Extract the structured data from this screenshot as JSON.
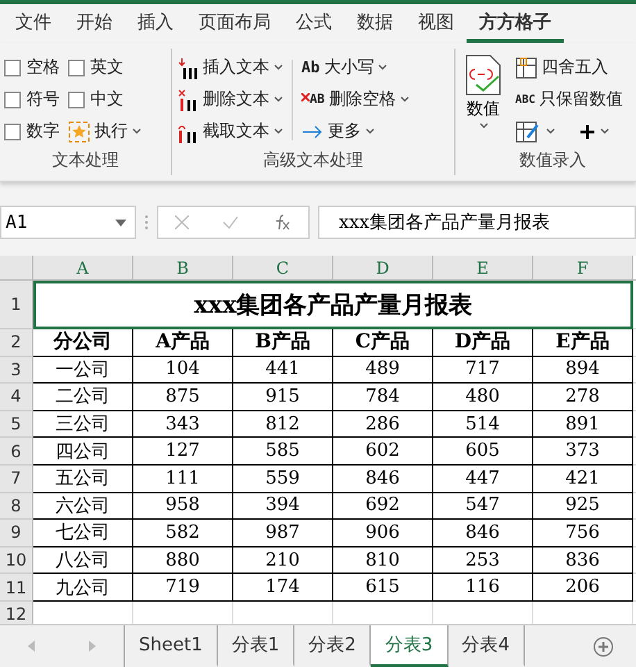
{
  "ribbon_tabs": [
    {
      "label": "文件",
      "selected": false
    },
    {
      "label": "开始",
      "selected": false
    },
    {
      "label": "插入",
      "selected": false
    },
    {
      "label": "页面布局",
      "selected": false
    },
    {
      "label": "公式",
      "selected": false
    },
    {
      "label": "数据",
      "selected": false
    },
    {
      "label": "视图",
      "selected": false
    },
    {
      "label": "方方格子",
      "selected": true
    }
  ],
  "text_group": {
    "label": "文本处理",
    "items": [
      {
        "kind": "checkbox",
        "label": "空格",
        "checked": false
      },
      {
        "kind": "checkbox",
        "label": "英文",
        "checked": false
      },
      {
        "kind": "checkbox",
        "label": "符号",
        "checked": false
      },
      {
        "kind": "checkbox",
        "label": "中文",
        "checked": false
      },
      {
        "kind": "checkbox",
        "label": "数字",
        "checked": false
      },
      {
        "kind": "button",
        "label": "执行"
      }
    ]
  },
  "advanced_group": {
    "label": "高级文本处理",
    "left": [
      {
        "kind": "insert",
        "label": "插入文本"
      },
      {
        "kind": "delete",
        "label": "删除文本"
      },
      {
        "kind": "cut",
        "label": "截取文本"
      }
    ],
    "right": [
      {
        "kind": "case",
        "label": "大小写",
        "icon_text": "Ab"
      },
      {
        "kind": "space",
        "label": "删除空格",
        "icon_text": "AB"
      },
      {
        "kind": "more",
        "label": "更多"
      }
    ]
  },
  "number_group": {
    "label": "数值录入",
    "big_button": "数值",
    "items": [
      {
        "kind": "round",
        "label": "四舍五入"
      },
      {
        "kind": "keep",
        "label": "只保留数值",
        "icon_text": "ABC"
      }
    ]
  },
  "formula_bar": {
    "cell_ref": "A1",
    "value": "xxx集团各产品产量月报表"
  },
  "sheet": {
    "columns": [
      "A",
      "B",
      "C",
      "D",
      "E",
      "F"
    ],
    "row_numbers": [
      "1",
      "2",
      "3",
      "4",
      "5",
      "6",
      "7",
      "8",
      "9",
      "10",
      "11",
      "12"
    ],
    "title": "xxx集团各产品产量月报表",
    "header": [
      "分公司",
      "A产品",
      "B产品",
      "C产品",
      "D产品",
      "E产品"
    ],
    "rows": [
      [
        "一公司",
        "104",
        "441",
        "489",
        "717",
        "894"
      ],
      [
        "二公司",
        "875",
        "915",
        "784",
        "480",
        "278"
      ],
      [
        "三公司",
        "343",
        "812",
        "286",
        "514",
        "891"
      ],
      [
        "四公司",
        "127",
        "585",
        "602",
        "605",
        "373"
      ],
      [
        "五公司",
        "111",
        "559",
        "846",
        "447",
        "421"
      ],
      [
        "六公司",
        "958",
        "394",
        "692",
        "547",
        "925"
      ],
      [
        "七公司",
        "582",
        "987",
        "906",
        "846",
        "756"
      ],
      [
        "八公司",
        "880",
        "210",
        "810",
        "253",
        "836"
      ],
      [
        "九公司",
        "719",
        "174",
        "615",
        "116",
        "206"
      ]
    ]
  },
  "sheet_tabs": [
    {
      "label": "Sheet1",
      "selected": false
    },
    {
      "label": "分表1",
      "selected": false
    },
    {
      "label": "分表2",
      "selected": false
    },
    {
      "label": "分表3",
      "selected": true
    },
    {
      "label": "分表4",
      "selected": false
    }
  ]
}
